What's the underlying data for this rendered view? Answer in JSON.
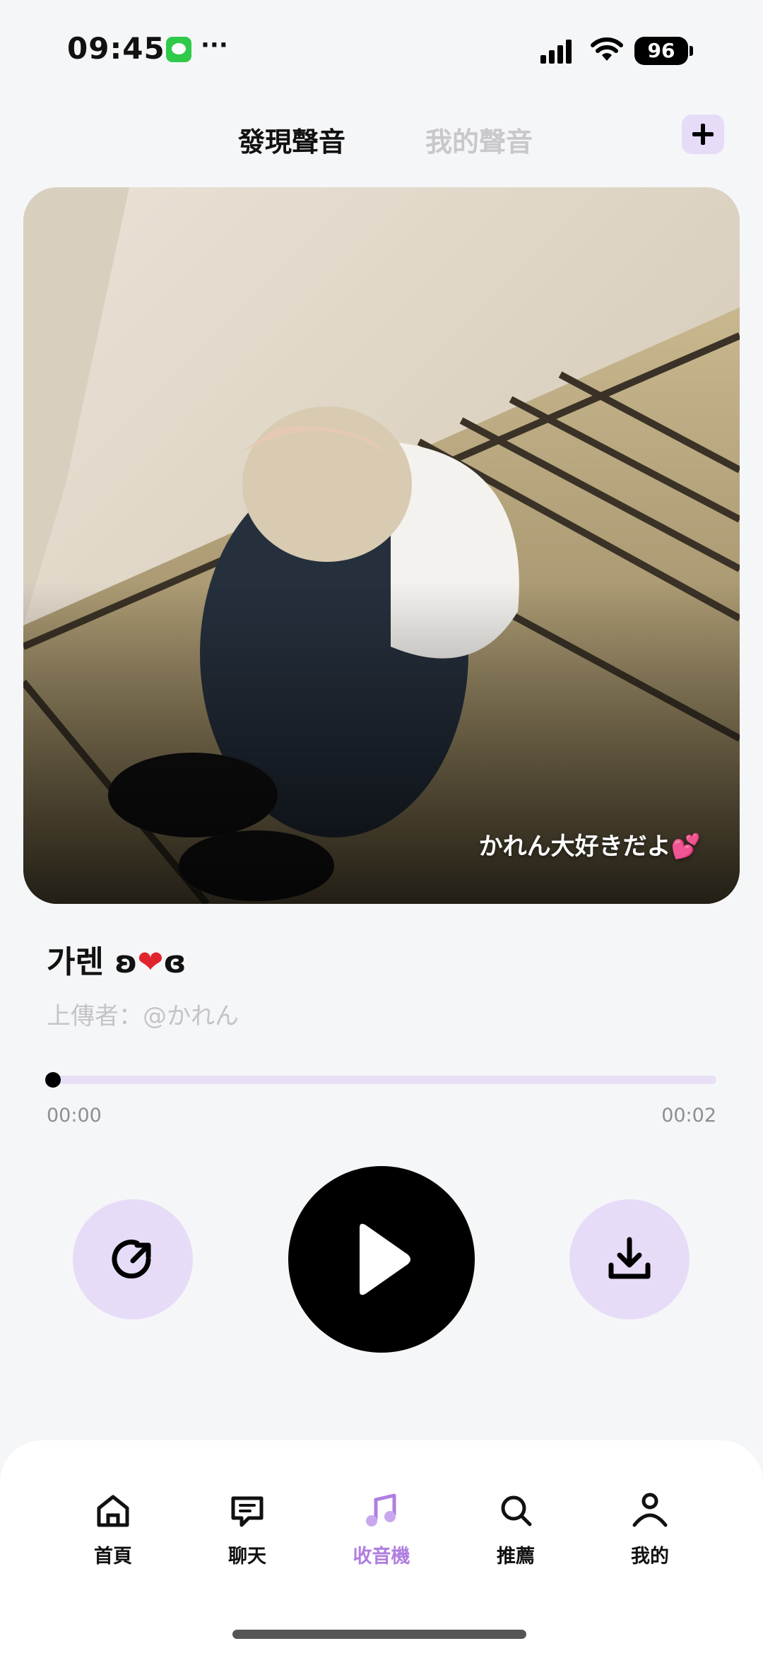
{
  "status_bar": {
    "time": "09:45",
    "dots": "···",
    "battery": "96",
    "icons": [
      "messages-icon",
      "signal-icon",
      "wifi-icon",
      "battery-icon"
    ]
  },
  "header": {
    "tabs": [
      {
        "label": "發現聲音",
        "active": true
      },
      {
        "label": "我的聲音",
        "active": false
      }
    ],
    "add_label": "+"
  },
  "cover": {
    "caption": "かれん大好きだよ",
    "caption_emoji": "💕"
  },
  "track": {
    "title_text": "가렌 ʚ",
    "title_heart": "❤",
    "title_end": "ɞ",
    "uploader": "上傳者：@かれん"
  },
  "progress": {
    "current": "00:00",
    "total": "00:02",
    "fraction": 0
  },
  "controls": {
    "icons": [
      "replay-icon",
      "play-icon",
      "download-icon"
    ]
  },
  "nav": {
    "items": [
      {
        "label": "首頁",
        "icon": "home-icon",
        "active": false
      },
      {
        "label": "聊天",
        "icon": "chat-icon",
        "active": false
      },
      {
        "label": "收音機",
        "icon": "music-note-icon",
        "active": true
      },
      {
        "label": "推薦",
        "icon": "search-icon",
        "active": false
      },
      {
        "label": "我的",
        "icon": "profile-icon",
        "active": false
      }
    ]
  },
  "colors": {
    "accent": "#b07ee0",
    "accent_light": "#e7dcf8",
    "background": "#f5f6f8"
  }
}
